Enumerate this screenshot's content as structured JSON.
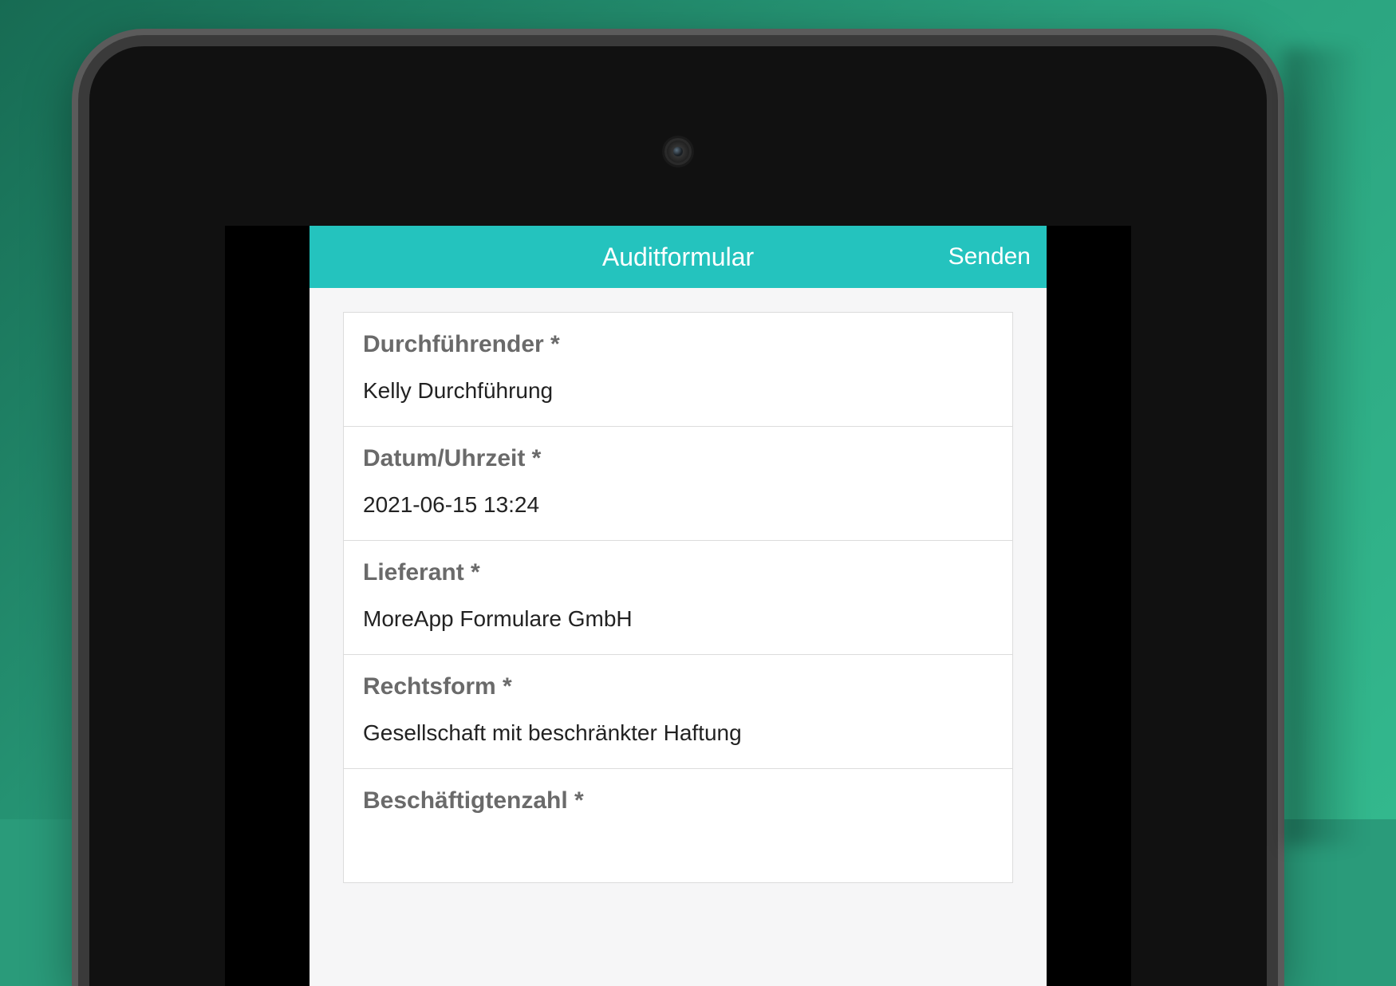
{
  "colors": {
    "accent": "#24c3be",
    "bg_gradient_start": "#176b53",
    "bg_gradient_end": "#33b88d"
  },
  "header": {
    "title": "Auditformular",
    "send_label": "Senden"
  },
  "form": {
    "fields": [
      {
        "label": "Durchführender *",
        "value": "Kelly Durchführung"
      },
      {
        "label": "Datum/Uhrzeit *",
        "value": "2021-06-15 13:24"
      },
      {
        "label": "Lieferant *",
        "value": "MoreApp Formulare GmbH"
      },
      {
        "label": "Rechtsform *",
        "value": "Gesellschaft mit beschränkter Haftung"
      },
      {
        "label": "Beschäftigtenzahl *",
        "value": ""
      }
    ]
  }
}
